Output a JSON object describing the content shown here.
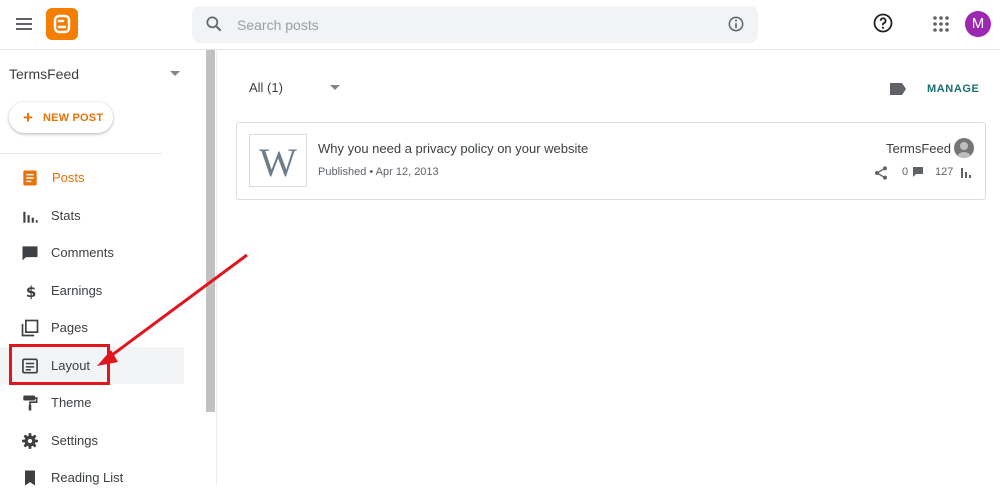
{
  "header": {
    "search_placeholder": "Search posts",
    "avatar_initial": "M",
    "colors": {
      "brand": "#f57d00",
      "avatar": "#9c27b0"
    }
  },
  "sidebar": {
    "blog_name": "TermsFeed",
    "new_post_label": "NEW POST",
    "items": [
      {
        "label": "Posts",
        "icon": "posts-icon",
        "selected": true
      },
      {
        "label": "Stats",
        "icon": "stats-icon"
      },
      {
        "label": "Comments",
        "icon": "comments-icon"
      },
      {
        "label": "Earnings",
        "icon": "dollar-icon"
      },
      {
        "label": "Pages",
        "icon": "pages-icon"
      },
      {
        "label": "Layout",
        "icon": "layout-icon",
        "hover": true
      },
      {
        "label": "Theme",
        "icon": "paint-roller-icon"
      },
      {
        "label": "Settings",
        "icon": "gear-icon"
      },
      {
        "label": "Reading List",
        "icon": "bookmark-icon"
      }
    ],
    "colors": {
      "accent": "#e8710a"
    }
  },
  "main": {
    "filter_label": "All (1)",
    "manage_label": "MANAGE",
    "post": {
      "thumb_letter": "W",
      "title": "Why you need a privacy policy on your website",
      "meta": "Published • Apr 12, 2013",
      "author": "TermsFeed",
      "comments": "0",
      "views": "127"
    }
  },
  "annotation": {
    "color": "#e0161e"
  }
}
